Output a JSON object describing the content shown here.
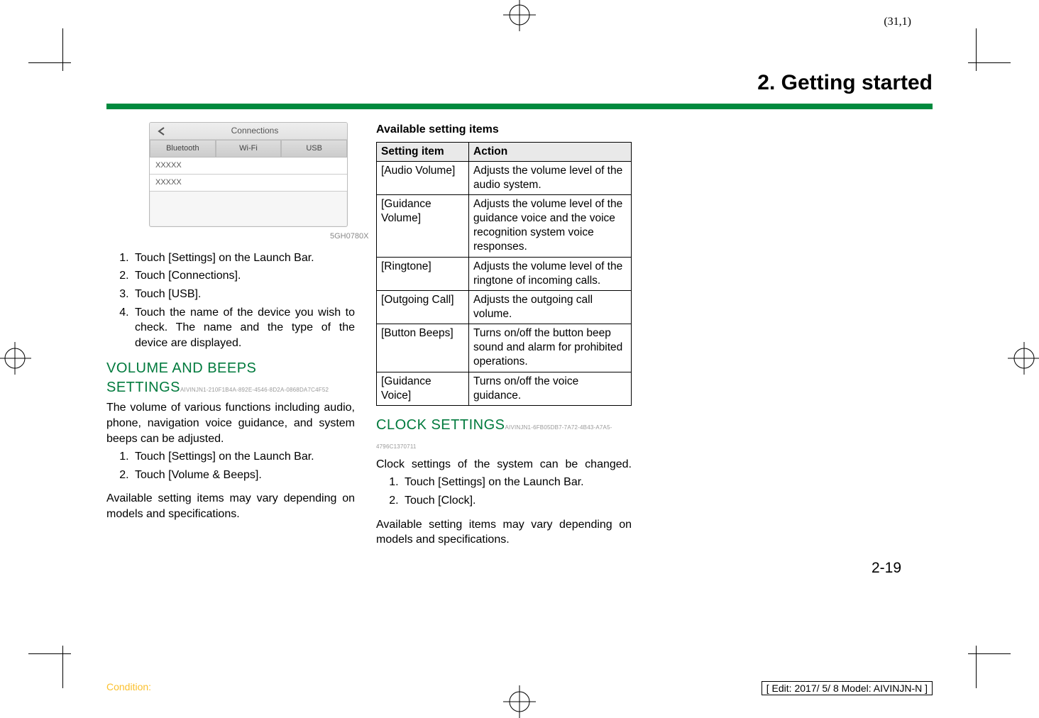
{
  "pagecoord": "(31,1)",
  "chapter_title": "2. Getting started",
  "ui": {
    "title": "Connections",
    "tabs": [
      "Bluetooth",
      "Wi-Fi",
      "USB"
    ],
    "rows": [
      "XXXXX",
      "XXXXX"
    ]
  },
  "img_ref": "5GH0780X",
  "col1": {
    "steps_a": [
      "Touch [Settings] on the Launch Bar.",
      "Touch [Connections].",
      "Touch [USB].",
      "Touch the name of the device you wish to check. The name and the type of the device are displayed."
    ],
    "section1_title": "VOLUME AND BEEPS SETTINGS",
    "section1_code": "AIVINJN1-210F1B4A-892E-4546-8D2A-0868DA7C4F52",
    "section1_intro": "The volume of various functions including audio, phone, navigation voice guidance, and system beeps can be adjusted.",
    "steps_b": [
      "Touch [Settings] on the Launch Bar.",
      "Touch [Volume & Beeps]."
    ],
    "section1_outro": "Available setting items may vary depending on models and specifications."
  },
  "col2": {
    "table_title": "Available setting items",
    "headers": [
      "Setting item",
      "Action"
    ],
    "rows": [
      {
        "item": "[Audio Volume]",
        "action": "Adjusts the volume level of the audio system."
      },
      {
        "item": "[Guidance Volume]",
        "action": "Adjusts the volume level of the guidance voice and the voice recognition system voice responses."
      },
      {
        "item": "[Ringtone]",
        "action": "Adjusts the volume level of the ringtone of incoming calls."
      },
      {
        "item": "[Outgoing Call]",
        "action": "Adjusts the outgoing call volume."
      },
      {
        "item": "[Button Beeps]",
        "action": "Turns on/off the button beep sound and alarm for prohibited operations."
      },
      {
        "item": "[Guidance Voice]",
        "action": "Turns on/off the voice guidance."
      }
    ],
    "section2_title": "CLOCK SETTINGS",
    "section2_code": "AIVINJN1-6FB05DB7-7A72-4B43-A7A5-4796C1370711",
    "section2_intro": "Clock settings of the system can be changed.",
    "steps_c": [
      "Touch [Settings] on the Launch Bar.",
      "Touch [Clock]."
    ],
    "section2_outro": "Available setting items may vary depending on models and specifications."
  },
  "footer": {
    "page_number": "2-19",
    "condition": "Condition:",
    "edit": "[ Edit: 2017/ 5/ 8    Model:  AIVINJN-N ]"
  }
}
